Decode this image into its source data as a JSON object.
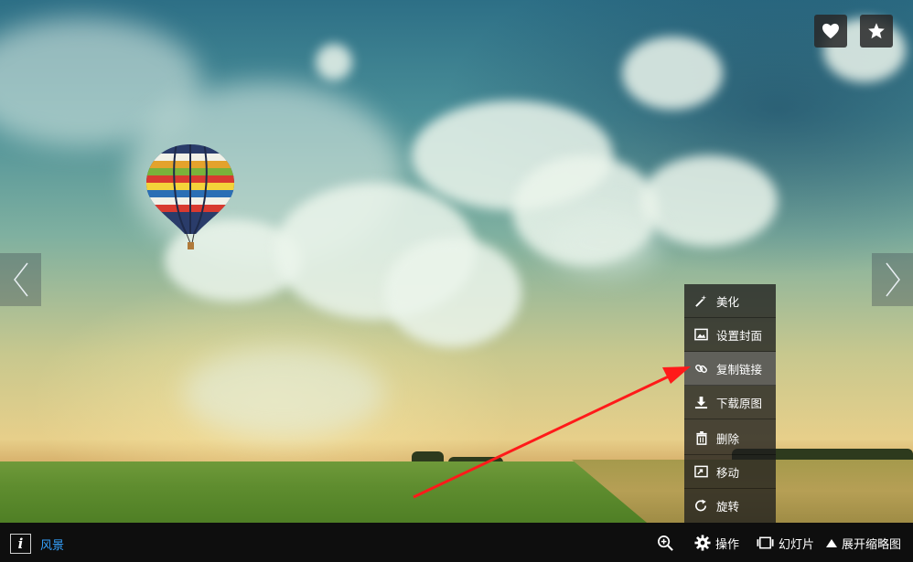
{
  "top_actions": {
    "like_icon": "heart-icon",
    "favorite_icon": "star-icon"
  },
  "navigation": {
    "prev_icon": "chevron-left-icon",
    "next_icon": "chevron-right-icon"
  },
  "operation_menu": {
    "items": [
      {
        "label": "美化",
        "icon": "magic-wand-icon"
      },
      {
        "label": "设置封面",
        "icon": "image-icon"
      },
      {
        "label": "复制链接",
        "icon": "link-icon",
        "highlighted": true
      },
      {
        "label": "下载原图",
        "icon": "download-icon"
      },
      {
        "label": "删除",
        "icon": "trash-icon"
      },
      {
        "label": "移动",
        "icon": "move-icon"
      },
      {
        "label": "旋转",
        "icon": "rotate-icon"
      }
    ]
  },
  "toolbar": {
    "info_label": "i",
    "album_name": "风景",
    "zoom_icon": "zoom-in-icon",
    "operations_label": "操作",
    "slideshow_label": "幻灯片",
    "expand_thumbnails_label": "展开缩略图"
  },
  "colors": {
    "album_link": "#35a2ff",
    "toolbar_bg": "#0e0e0e",
    "annotation_arrow": "#ff1a1a"
  }
}
